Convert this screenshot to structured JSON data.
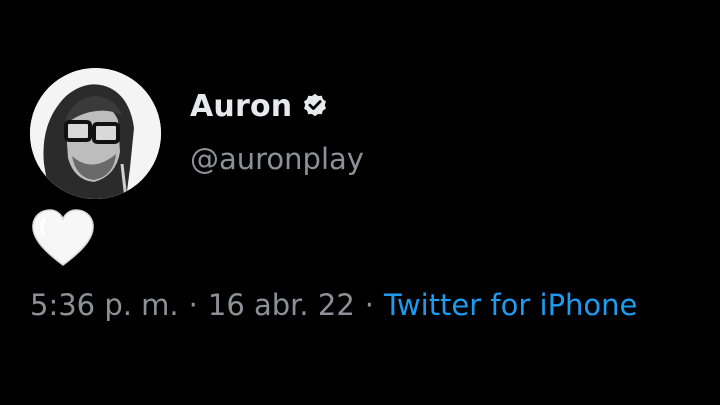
{
  "tweet": {
    "author": {
      "display_name": "Auron",
      "handle": "@auronplay",
      "verified": true
    },
    "content": {
      "emoji": "white-heart"
    },
    "meta": {
      "time": "5:36 p. m.",
      "separator": "·",
      "date": "16 abr. 22",
      "source": "Twitter for iPhone"
    }
  },
  "colors": {
    "background": "#000000",
    "primary_text": "#e7e9ea",
    "secondary_text": "#8b9197",
    "link": "#1d9bf0",
    "verified_badge": "#e7e9ea"
  },
  "icons": {
    "verified": "verified-badge-icon",
    "heart": "white-heart-icon"
  }
}
